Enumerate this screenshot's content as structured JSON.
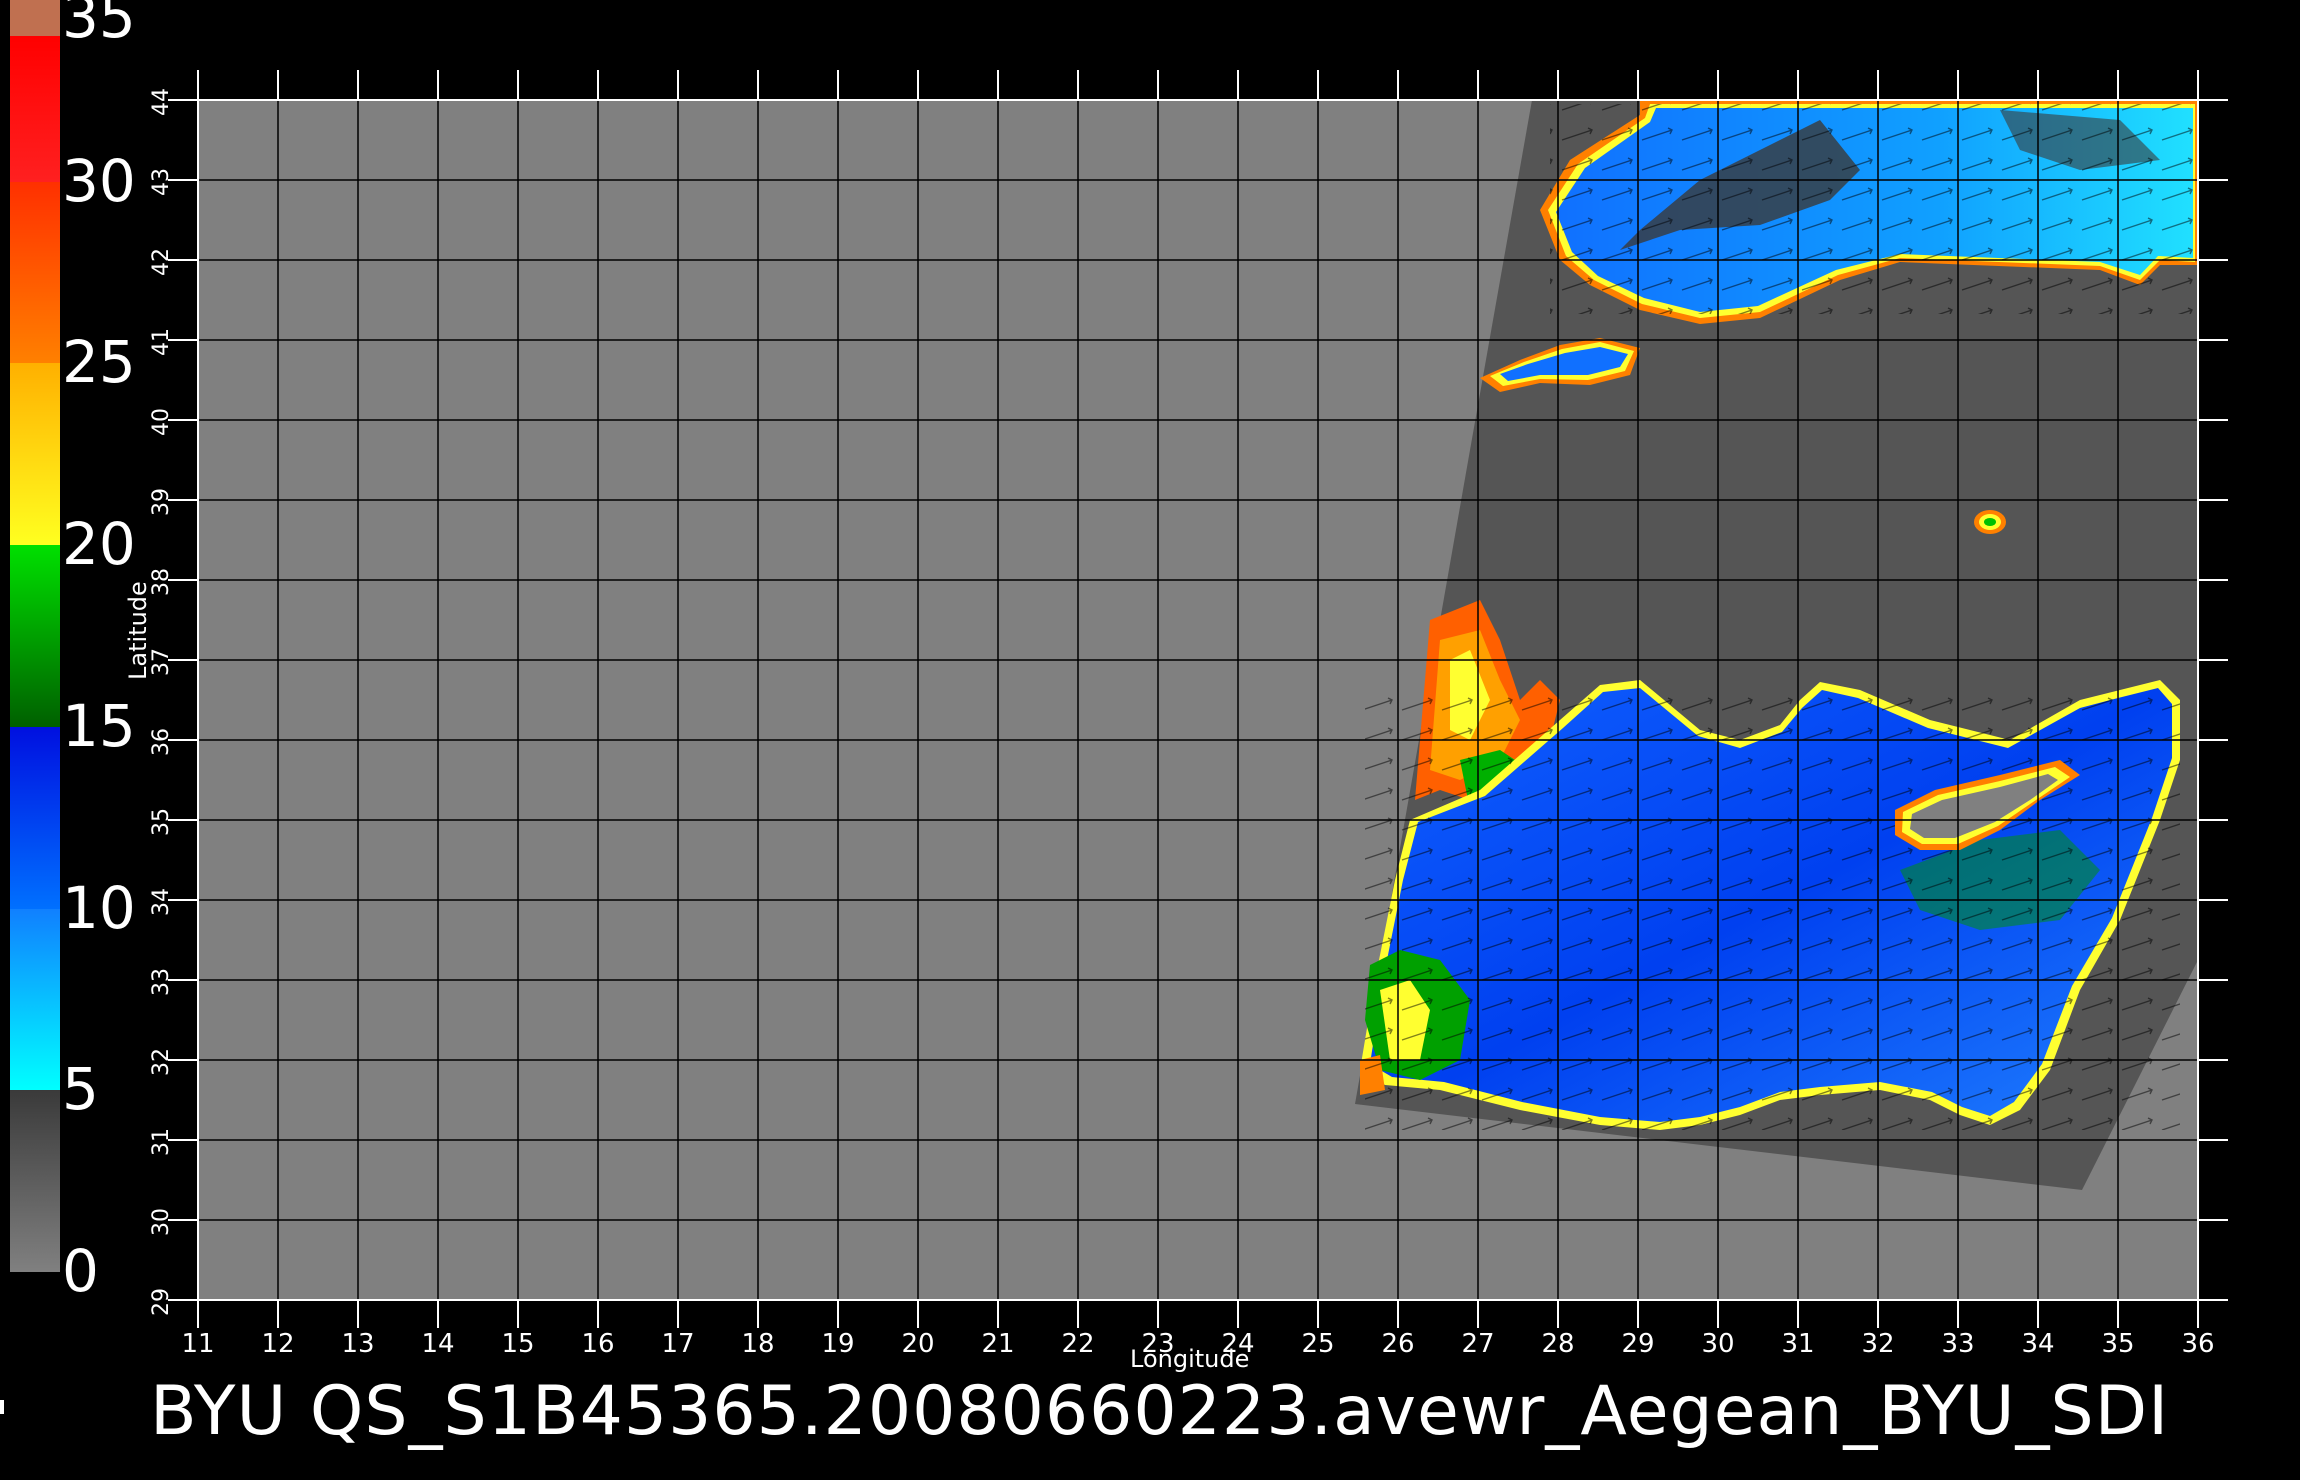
{
  "title": "BYU  QS_S1B45365.20080660223.avewr_Aegean_BYU_SDI",
  "xlabel": "Longitude",
  "ylabel": "Latitude",
  "longitude_ticks": [
    "11",
    "12",
    "13",
    "14",
    "15",
    "16",
    "17",
    "18",
    "19",
    "20",
    "21",
    "22",
    "23",
    "24",
    "25",
    "26",
    "27",
    "28",
    "29",
    "30",
    "31",
    "32",
    "33",
    "34",
    "35",
    "36"
  ],
  "latitude_ticks": [
    "29",
    "30",
    "31",
    "32",
    "33",
    "34",
    "35",
    "36",
    "37",
    "38",
    "39",
    "40",
    "41",
    "42",
    "43",
    "44"
  ],
  "colorbar": {
    "labels": [
      "35",
      "30",
      "25",
      "20",
      "15",
      "10",
      "5",
      "0"
    ],
    "segments": [
      {
        "from": 0,
        "to": 5,
        "colors": [
          "#808080",
          "#3a3a3a"
        ]
      },
      {
        "from": 5,
        "to": 10,
        "colors": [
          "#00ffff",
          "#1080ff"
        ]
      },
      {
        "from": 10,
        "to": 15,
        "colors": [
          "#0070ff",
          "#0010e0"
        ]
      },
      {
        "from": 15,
        "to": 20,
        "colors": [
          "#006000",
          "#00e000"
        ]
      },
      {
        "from": 20,
        "to": 25,
        "colors": [
          "#ffff20",
          "#ffb000"
        ]
      },
      {
        "from": 25,
        "to": 30,
        "colors": [
          "#ff8000",
          "#ff3000"
        ]
      },
      {
        "from": 30,
        "to": 34,
        "colors": [
          "#ff2020",
          "#ff0000"
        ]
      },
      {
        "from": 34,
        "to": 35,
        "colors": [
          "#c07050",
          "#c07050"
        ]
      }
    ],
    "range": [
      0,
      35
    ]
  },
  "map_extent": {
    "lon": [
      11,
      36
    ],
    "lat": [
      29,
      44
    ]
  },
  "colors": {
    "background": "#000000",
    "plot_area": "#808080",
    "land_masked": "#555555",
    "grid": "#000000"
  }
}
